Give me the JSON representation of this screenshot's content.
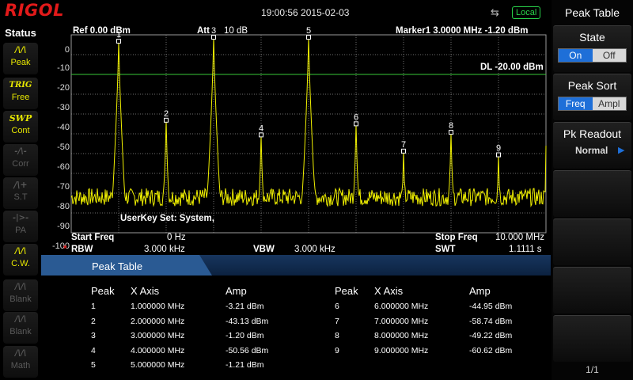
{
  "brand": "RIGOL",
  "datetime": "19:00:56 2015-02-03",
  "local_badge": "Local",
  "status": {
    "title": "Status",
    "items": [
      {
        "id": "peak",
        "icon": "peak-icon",
        "glyph": "/\\/\\",
        "label": "Peak",
        "active": true
      },
      {
        "id": "trig",
        "icon": "trig-icon",
        "glyph": "TRIG",
        "label": "Free",
        "active": true
      },
      {
        "id": "swp",
        "icon": "swp-icon",
        "glyph": "SWP",
        "label": "Cont",
        "active": true
      },
      {
        "id": "corr",
        "icon": "corr-icon",
        "glyph": "-/\\-",
        "label": "Corr",
        "active": false
      },
      {
        "id": "st",
        "icon": "st-icon",
        "glyph": "/\\+",
        "label": "S.T",
        "active": false
      },
      {
        "id": "pa",
        "icon": "pa-icon",
        "glyph": "-|>-",
        "label": "PA",
        "active": false
      },
      {
        "id": "cw",
        "icon": "cw-icon",
        "glyph": "/\\/\\",
        "label": "C.W.",
        "active": true
      },
      {
        "id": "blank1",
        "icon": "blank-icon",
        "glyph": "/\\/\\",
        "label": "Blank",
        "active": false
      },
      {
        "id": "blank2",
        "icon": "blank-icon",
        "glyph": "/\\/\\",
        "label": "Blank",
        "active": false
      },
      {
        "id": "math",
        "icon": "math-icon",
        "glyph": "/\\/\\",
        "label": "Math",
        "active": false
      }
    ]
  },
  "menu": {
    "title": "Peak Table",
    "state": {
      "label": "State",
      "on": "On",
      "off": "Off"
    },
    "sort": {
      "label": "Peak Sort",
      "freq": "Freq",
      "ampl": "Ampl"
    },
    "readout": {
      "label": "Pk Readout",
      "value": "Normal"
    },
    "page": "1/1"
  },
  "plot": {
    "ref": "Ref  0.00 dBm",
    "att_label": "Att",
    "att_value": "10 dB",
    "marker": "Marker1  3.0000 MHz  -1.20 dBm",
    "dl": "DL -20.00 dBm",
    "userkey": "UserKey Set:    System,",
    "start_label": "Start Freq",
    "start_value": "0 Hz",
    "stop_label": "Stop Freq",
    "stop_value": "10.000 MHz",
    "rbw_star": "*",
    "rbw_label": "RBW",
    "rbw_value": "3.000 kHz",
    "vbw_label": "VBW",
    "vbw_value": "3.000 kHz",
    "swt_label": "SWT",
    "swt_value": "1.1111 s",
    "y_ticks": [
      "0",
      "-10",
      "-20",
      "-30",
      "-40",
      "-50",
      "-60",
      "-70",
      "-80",
      "-90",
      "-100"
    ]
  },
  "chart_data": {
    "type": "line",
    "xlabel": "",
    "ylabel": "",
    "xlim": [
      0,
      10
    ],
    "ylim": [
      -100,
      0
    ],
    "display_line": -20,
    "noise_floor": -82,
    "peaks": [
      {
        "n": 1,
        "x": 1.0,
        "y": -3.21
      },
      {
        "n": 2,
        "x": 2.0,
        "y": -43.13
      },
      {
        "n": 3,
        "x": 3.0,
        "y": -1.2
      },
      {
        "n": 4,
        "x": 4.0,
        "y": -50.56
      },
      {
        "n": 5,
        "x": 5.0,
        "y": -1.21
      },
      {
        "n": 6,
        "x": 6.0,
        "y": -44.95
      },
      {
        "n": 7,
        "x": 7.0,
        "y": -58.74
      },
      {
        "n": 8,
        "x": 8.0,
        "y": -49.22
      },
      {
        "n": 9,
        "x": 9.0,
        "y": -60.62
      }
    ]
  },
  "peak_table": {
    "title": "Peak Table",
    "headers": [
      "Peak",
      "X Axis",
      "Amp"
    ],
    "rows": [
      {
        "peak": "1",
        "x": "1.000000 MHz",
        "amp": "-3.21 dBm"
      },
      {
        "peak": "2",
        "x": "2.000000 MHz",
        "amp": "-43.13 dBm"
      },
      {
        "peak": "3",
        "x": "3.000000 MHz",
        "amp": "-1.20 dBm"
      },
      {
        "peak": "4",
        "x": "4.000000 MHz",
        "amp": "-50.56 dBm"
      },
      {
        "peak": "5",
        "x": "5.000000 MHz",
        "amp": "-1.21 dBm"
      },
      {
        "peak": "6",
        "x": "6.000000 MHz",
        "amp": "-44.95 dBm"
      },
      {
        "peak": "7",
        "x": "7.000000 MHz",
        "amp": "-58.74 dBm"
      },
      {
        "peak": "8",
        "x": "8.000000 MHz",
        "amp": "-49.22 dBm"
      },
      {
        "peak": "9",
        "x": "9.000000 MHz",
        "amp": "-60.62 dBm"
      }
    ]
  },
  "colors": {
    "trace": "#f0f000",
    "grid": "#6e6e6e",
    "display_line": "#39c739",
    "accent": "#1e6fd8",
    "brand": "#e21a1a"
  }
}
